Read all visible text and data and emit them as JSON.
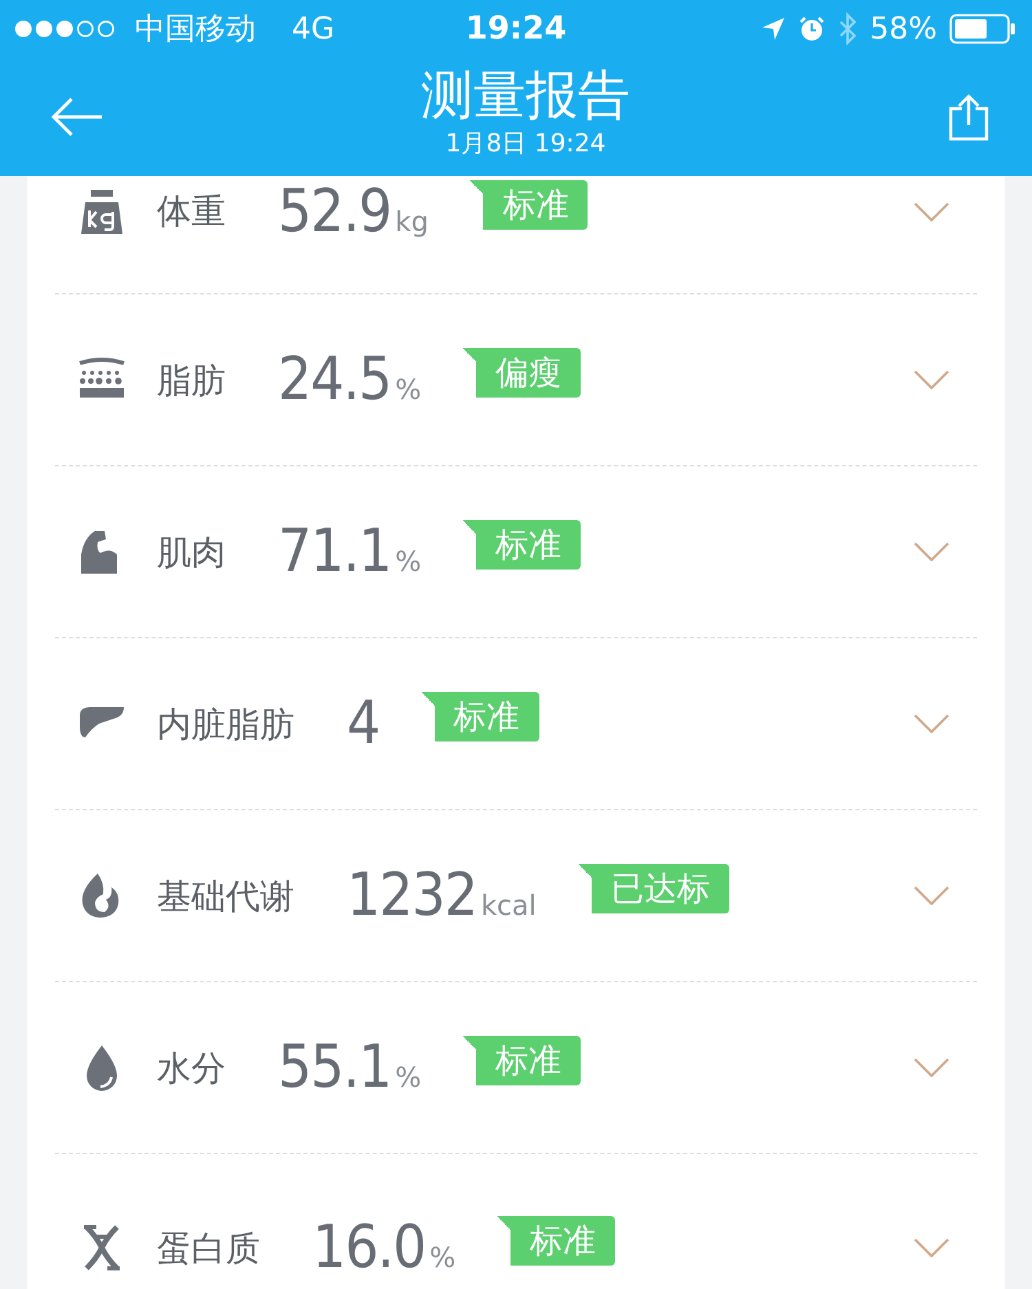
{
  "status_bar": {
    "carrier": "中国移动",
    "network": "4G",
    "time": "19:24",
    "battery": "58%"
  },
  "header": {
    "title": "测量报告",
    "subtitle": "1月8日 19:24"
  },
  "metrics": [
    {
      "kind": "weight",
      "name": "体重",
      "value": "52.9",
      "unit": "kg",
      "tag": "标准"
    },
    {
      "kind": "fat",
      "name": "脂肪",
      "value": "24.5",
      "unit": "%",
      "tag": "偏瘦"
    },
    {
      "kind": "muscle",
      "name": "肌肉",
      "value": "71.1",
      "unit": "%",
      "tag": "标准"
    },
    {
      "kind": "visceral",
      "name": "内脏脂肪",
      "value": "4",
      "tag": "标准"
    },
    {
      "kind": "metabolism",
      "name": "基础代谢",
      "value": "1232",
      "unit": "kcal",
      "tag": "已达标"
    },
    {
      "kind": "water",
      "name": "水分",
      "value": "55.1",
      "unit": "%",
      "tag": "标准"
    },
    {
      "kind": "protein",
      "name": "蛋白质",
      "value": "16.0",
      "unit": "%",
      "tag": "标准"
    }
  ]
}
